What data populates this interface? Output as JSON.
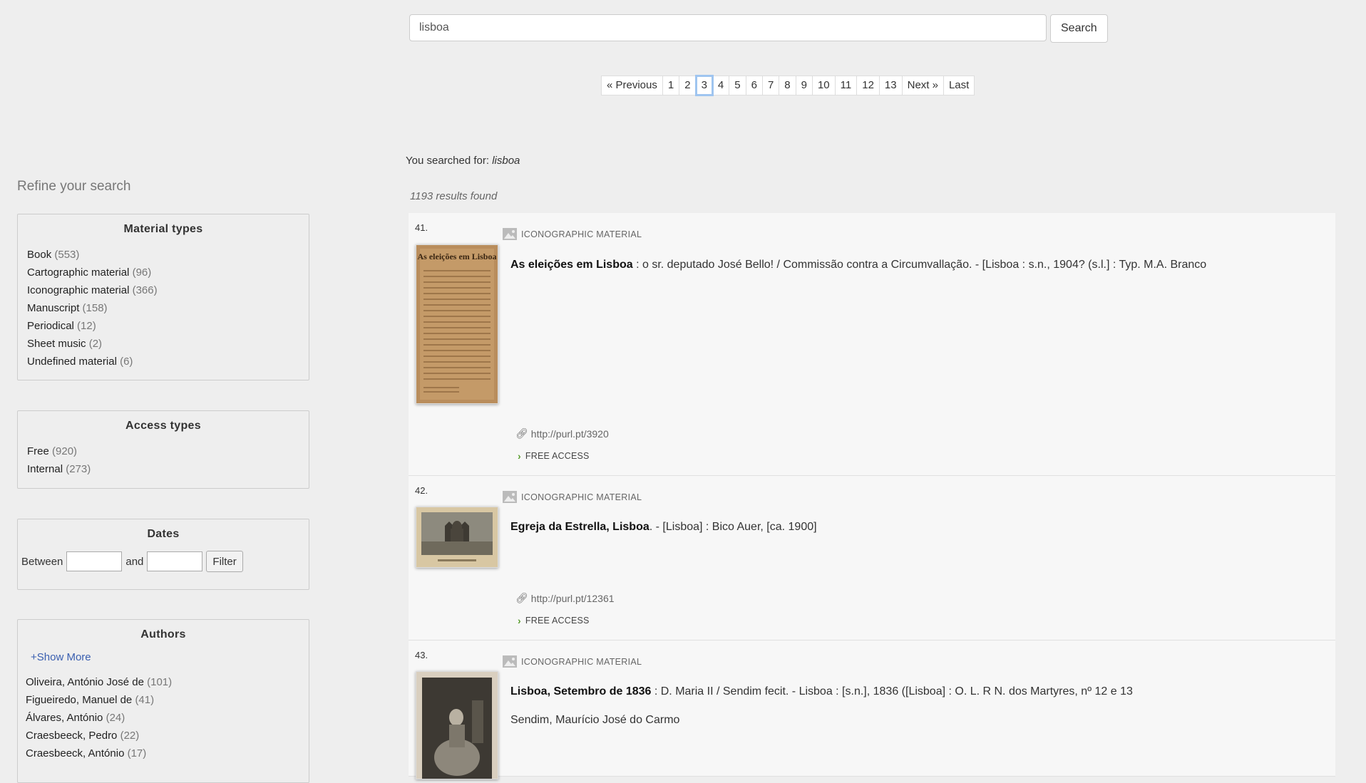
{
  "search": {
    "value": "lisboa",
    "button_label": "Search"
  },
  "pagination": {
    "previous": "« Previous",
    "pages": [
      "1",
      "2",
      "3",
      "4",
      "5",
      "6",
      "7",
      "8",
      "9",
      "10",
      "11",
      "12",
      "13"
    ],
    "current": "3",
    "next": "Next »",
    "last": "Last"
  },
  "summary": {
    "searched_prefix": "You searched for:",
    "searched_term": "lisboa",
    "results_found": "1193 results found"
  },
  "sidebar": {
    "refine_title": "Refine your search",
    "material_types": {
      "title": "Material types",
      "items": [
        {
          "label": "Book",
          "count": "(553)"
        },
        {
          "label": "Cartographic material",
          "count": "(96)"
        },
        {
          "label": "Iconographic material",
          "count": "(366)"
        },
        {
          "label": "Manuscript",
          "count": "(158)"
        },
        {
          "label": "Periodical",
          "count": "(12)"
        },
        {
          "label": "Sheet music",
          "count": "(2)"
        },
        {
          "label": "Undefined material",
          "count": "(6)"
        }
      ]
    },
    "access_types": {
      "title": "Access types",
      "items": [
        {
          "label": "Free",
          "count": "(920)"
        },
        {
          "label": "Internal",
          "count": "(273)"
        }
      ]
    },
    "dates": {
      "title": "Dates",
      "between": "Between",
      "and": "and",
      "filter": "Filter"
    },
    "authors": {
      "title": "Authors",
      "show_more": "+Show More",
      "items": [
        {
          "label": "Oliveira, António José de",
          "count": "(101)"
        },
        {
          "label": "Figueiredo, Manuel de",
          "count": "(41)"
        },
        {
          "label": "Álvares, António",
          "count": "(24)"
        },
        {
          "label": "Craesbeeck, Pedro",
          "count": "(22)"
        },
        {
          "label": "Craesbeeck, António",
          "count": "(17)"
        }
      ]
    }
  },
  "results": [
    {
      "number": "41.",
      "type": "ICONOGRAPHIC MATERIAL",
      "title_bold": "As eleições em Lisboa",
      "title_rest": " : o sr. deputado José Bello! / Commissão contra a Circumvallação. - [Lisboa : s.n., 1904? (s.l.] : Typ. M.A. Branco",
      "thumb_text": "As eleições em Lisboa",
      "purl": "http://purl.pt/3920",
      "access": "FREE ACCESS"
    },
    {
      "number": "42.",
      "type": "ICONOGRAPHIC MATERIAL",
      "title_bold": "Egreja da Estrella, Lisboa",
      "title_rest": ". - [Lisboa] : Bico Auer, [ca. 1900]",
      "purl": "http://purl.pt/12361",
      "access": "FREE ACCESS"
    },
    {
      "number": "43.",
      "type": "ICONOGRAPHIC MATERIAL",
      "title_bold": "Lisboa, Setembro de 1836",
      "title_rest": " : D. Maria II / Sendim fecit. - Lisboa : [s.n.], 1836 ([Lisboa] : O. L. R N. dos Martyres, nº 12 e 13",
      "author": "Sendim, Maurício José do Carmo"
    }
  ],
  "colors": {
    "accent": "#3a5fb0",
    "access_chevron": "#5a9e2f",
    "active_page_outline": "#9fc5f0"
  }
}
